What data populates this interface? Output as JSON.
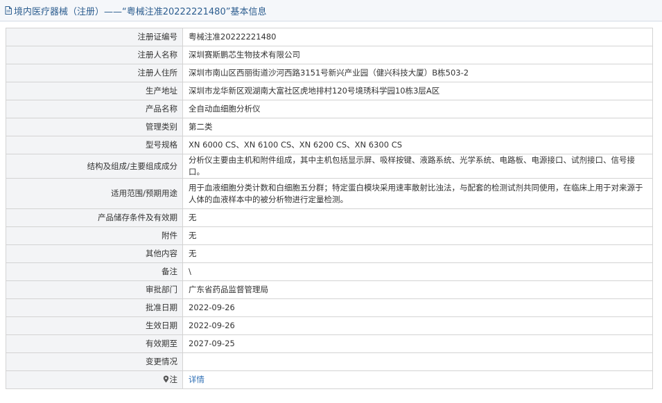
{
  "header": {
    "title": "境内医疗器械（注册）——“粤械注准20222221480”基本信息",
    "icon": "document-icon"
  },
  "rows": [
    {
      "label": "注册证编号",
      "value": "粤械注准20222221480"
    },
    {
      "label": "注册人名称",
      "value": "深圳赛斯鹏芯生物技术有限公司"
    },
    {
      "label": "注册人住所",
      "value": "深圳市南山区西丽街道沙河西路3151号新兴产业园（健兴科技大厦）B栋503-2"
    },
    {
      "label": "生产地址",
      "value": "深圳市龙华新区观湖南大富社区虎地排村120号境琇科学园10栋3层A区"
    },
    {
      "label": "产品名称",
      "value": "全自动血细胞分析仪"
    },
    {
      "label": "管理类别",
      "value": "第二类"
    },
    {
      "label": "型号规格",
      "value": "XN 6000 CS、XN 6100 CS、XN 6200 CS、XN 6300 CS"
    },
    {
      "label": "结构及组成/主要组成成分",
      "value": "分析仪主要由主机和附件组成，其中主机包括显示屏、吸样按键、液路系统、光学系统、电路板、电源接口、试剂接口、信号接口。"
    },
    {
      "label": "适用范围/预期用途",
      "value": "用于血液细胞分类计数和白细胞五分群；特定蛋白模块采用速率散射比浊法，与配套的检测试剂共同使用，在临床上用于对来源于人体的血液样本中的被分析物进行定量检测。"
    },
    {
      "label": "产品储存条件及有效期",
      "value": "无"
    },
    {
      "label": "附件",
      "value": "无"
    },
    {
      "label": "其他内容",
      "value": "无"
    },
    {
      "label": "备注",
      "value": "\\"
    },
    {
      "label": "审批部门",
      "value": "广东省药品监督管理局"
    },
    {
      "label": "批准日期",
      "value": "2022-09-26"
    },
    {
      "label": "生效日期",
      "value": "2022-09-26"
    },
    {
      "label": "有效期至",
      "value": "2027-09-25"
    },
    {
      "label": "变更情况",
      "value": ""
    }
  ],
  "note_row": {
    "label": "注",
    "icon": "pin-icon",
    "link_text": "详情"
  },
  "colors": {
    "title_text": "#2c5d8f",
    "label_bg": "#f3f4f6",
    "border": "#d3d3d3",
    "link": "#2f6fb5"
  }
}
